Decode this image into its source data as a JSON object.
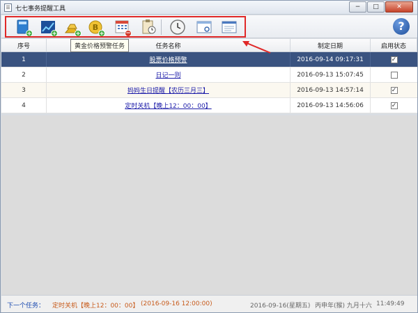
{
  "window": {
    "title": "七七事务提醒工具",
    "minimize_label": "−",
    "maximize_label": "□",
    "close_label": "✕"
  },
  "toolbar": {
    "tooltip": "黄金价格预警任务",
    "help_label": "?"
  },
  "table": {
    "headers": [
      "序号",
      "任务名称",
      "制定日期",
      "启用状态"
    ],
    "rows": [
      {
        "no": "1",
        "name": "股票价格预警",
        "date": "2016-09-14 09:17:31",
        "enabled": true
      },
      {
        "no": "2",
        "name": "日记一则",
        "date": "2016-09-13 15:07:45",
        "enabled": false
      },
      {
        "no": "3",
        "name": "妈妈生日提醒【农历三月三】",
        "date": "2016-09-13 14:57:14",
        "enabled": true
      },
      {
        "no": "4",
        "name": "定时关机【晚上12：00：00】",
        "date": "2016-09-13 14:56:06",
        "enabled": true
      }
    ]
  },
  "status": {
    "next_label": "下一个任务：",
    "next_task": "定时关机【晚上12：00：00】",
    "next_when": "(2016-09-16 12:00:00)",
    "date": "2016-09-16(星期五)",
    "lunar": "丙申年(猴) 九月十六",
    "time": "11:49:49"
  },
  "colors": {
    "selected_row": "#3a5380",
    "highlight_box": "#e02828",
    "status_accent": "#c75a1a",
    "status_label": "#1a4ab0"
  }
}
